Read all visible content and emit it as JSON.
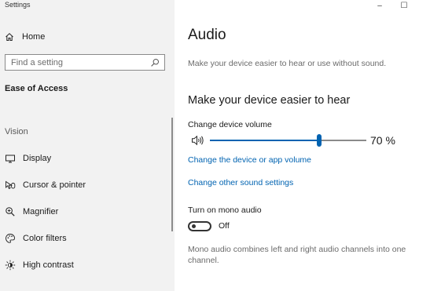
{
  "app": {
    "title": "Settings"
  },
  "window_controls": {
    "minimize": "–",
    "maximize": "☐"
  },
  "sidebar": {
    "home_label": "Home",
    "search_placeholder": "Find a setting",
    "section_title": "Ease of Access",
    "group_label": "Vision",
    "items": [
      {
        "label": "Display",
        "icon": "display-icon"
      },
      {
        "label": "Cursor & pointer",
        "icon": "cursor-icon"
      },
      {
        "label": "Magnifier",
        "icon": "magnifier-icon"
      },
      {
        "label": "Color filters",
        "icon": "color-filters-icon"
      },
      {
        "label": "High contrast",
        "icon": "high-contrast-icon"
      }
    ]
  },
  "main": {
    "title": "Audio",
    "description": "Make your device easier to hear or use without sound.",
    "subheading": "Make your device easier to hear",
    "volume": {
      "label": "Change device volume",
      "value_percent": 70,
      "value_text": "70 %"
    },
    "links": {
      "app_volume": "Change the device or app volume",
      "sound_settings": "Change other sound settings"
    },
    "mono_audio": {
      "label": "Turn on mono audio",
      "state": "Off",
      "description": "Mono audio combines left and right audio channels into one channel."
    }
  },
  "colors": {
    "accent": "#0063b1",
    "sidebar_bg": "#f2f2f2",
    "content_bg": "#ffffff"
  }
}
